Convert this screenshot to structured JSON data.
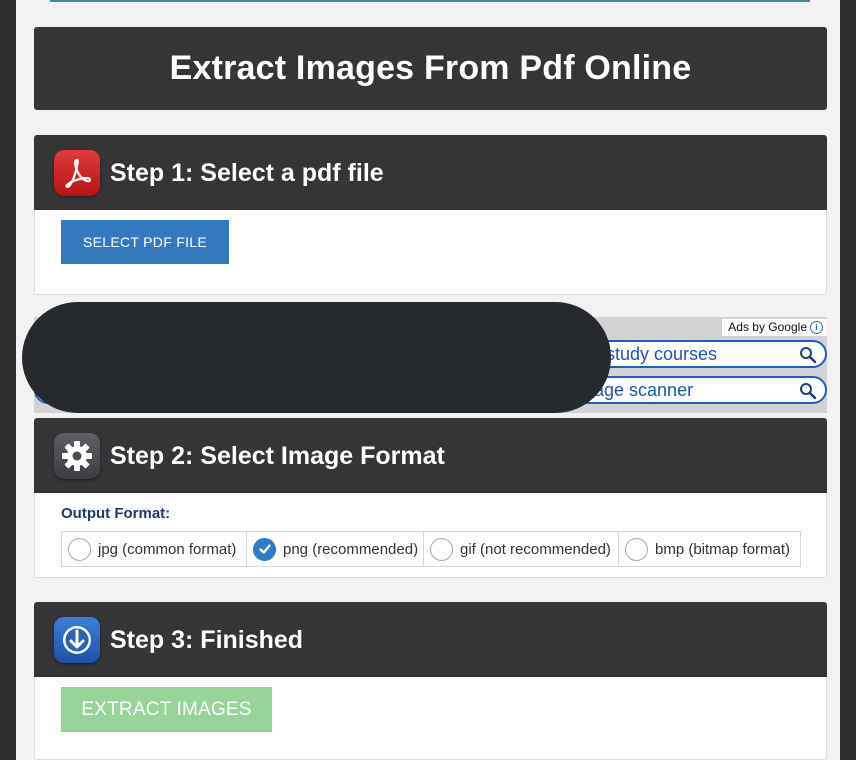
{
  "page": {
    "title": "Extract Images From Pdf Online"
  },
  "step1": {
    "title": "Step 1: Select a pdf file",
    "button_label": "SELECT PDF FILE",
    "icon": "pdf-icon"
  },
  "ads": {
    "label": "Ads by Google",
    "info_glyph": "i",
    "items": [
      "study courses",
      "age scanner"
    ]
  },
  "step2": {
    "title": "Step 2: Select Image Format",
    "icon": "gear-icon",
    "output_label": "Output Format:",
    "options": [
      {
        "label": "jpg (common format)",
        "checked": false
      },
      {
        "label": "png (recommended)",
        "checked": true
      },
      {
        "label": "gif (not recommended)",
        "checked": false
      },
      {
        "label": "bmp (bitmap format)",
        "checked": false
      }
    ]
  },
  "step3": {
    "title": "Step 3: Finished",
    "icon": "download-icon",
    "button_label": "EXTRACT IMAGES"
  },
  "colors": {
    "header": "#353538",
    "primary": "#3478bd",
    "extract_disabled": "#97d49a",
    "radio_checked": "#2e7cc4"
  }
}
